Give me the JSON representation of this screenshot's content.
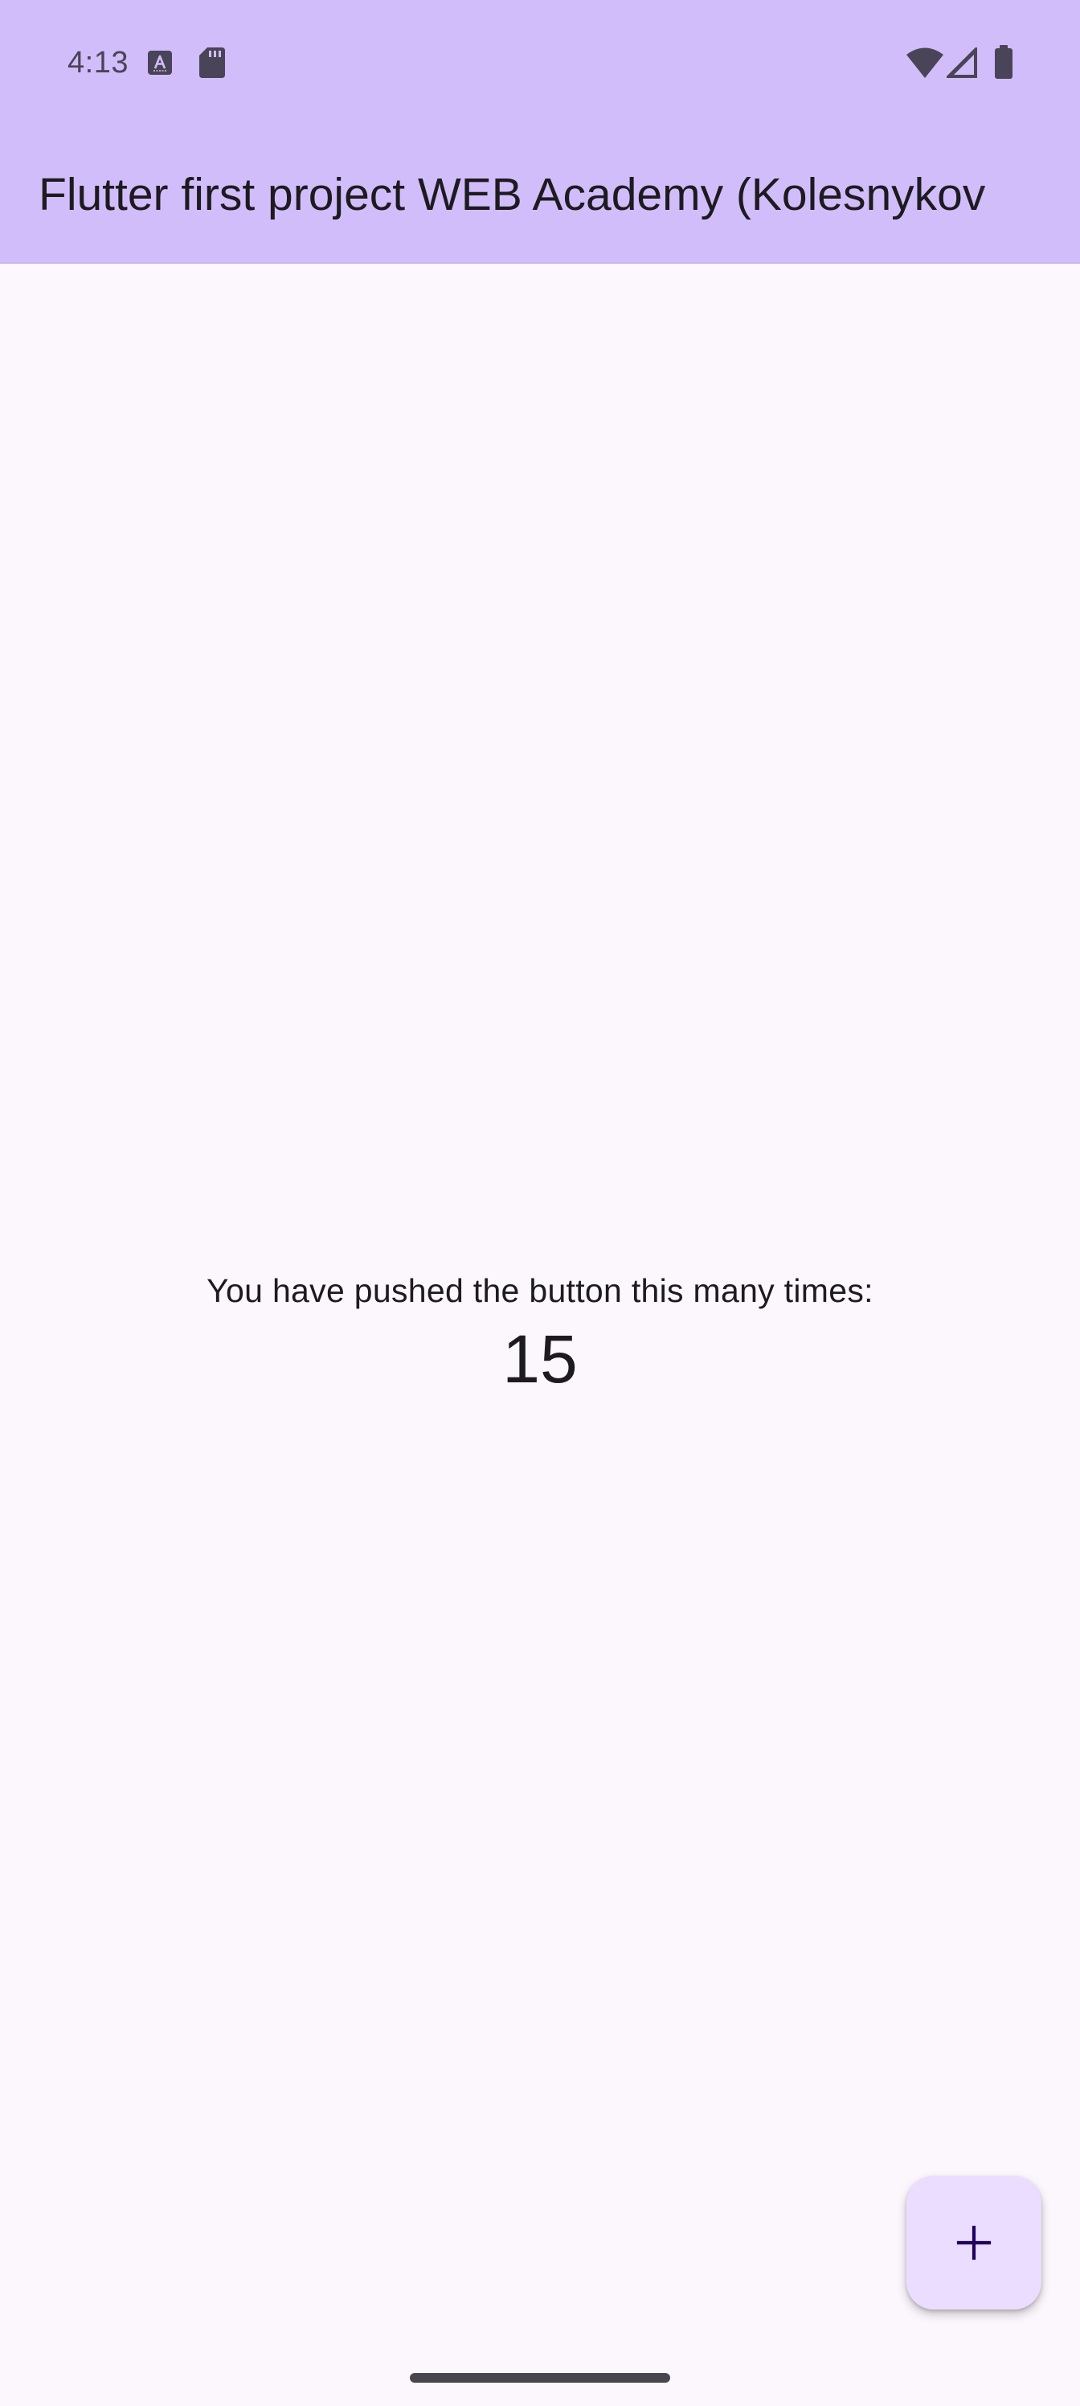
{
  "status_bar": {
    "time": "4:13",
    "left_icons": [
      "text-a-notification-icon",
      "sd-card-icon"
    ],
    "right_icons": [
      "wifi-icon",
      "cellular-signal-icon",
      "battery-icon"
    ]
  },
  "app_bar": {
    "title": "Flutter first project WEB Academy (Kolesnykov"
  },
  "main": {
    "counter_label": "You have pushed the button this many times:",
    "counter_value": "15"
  },
  "fab": {
    "icon": "plus-icon"
  },
  "colors": {
    "app_bar": "#D2BDFB",
    "background": "#FCF6FD",
    "fab": "#EADDFF",
    "text": "#1D1B20"
  }
}
